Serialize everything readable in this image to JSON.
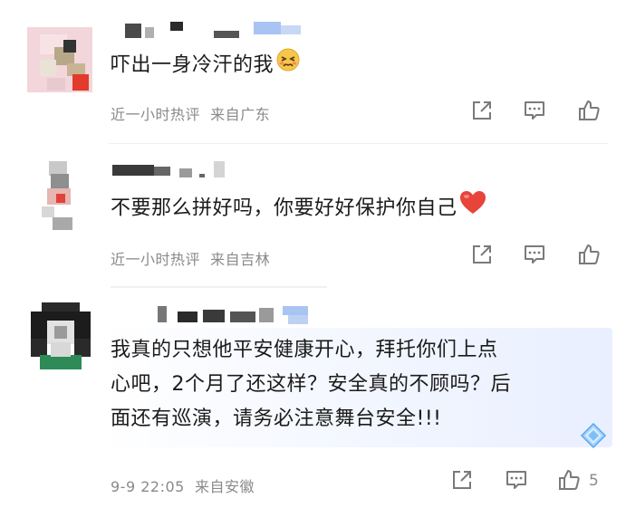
{
  "comments": [
    {
      "text": "吓出一身冷汗的我",
      "emoji": "sad-face-emoji",
      "meta": "近一小时热评  来自广东",
      "likes": ""
    },
    {
      "text": "不要那么拼好吗，你要好好保护你自己",
      "emoji": "red-heart-emoji",
      "meta": "近一小时热评  来自吉林",
      "likes": ""
    },
    {
      "text_lines": [
        "我真的只想他平安健康开心，拜托你们上点",
        "心吧，2个月了还这样？安全真的不顾吗？后",
        "面还有巡演，请务必注意舞台安全!!!"
      ],
      "meta": "9-9 22:05  来自安徽",
      "likes": "5"
    }
  ],
  "icons": {
    "share": "share-icon",
    "reply": "comment-icon",
    "like": "thumbs-up-icon",
    "badge": "diamond-badge-icon"
  },
  "colors": {
    "meta_text": "#8a8a8a",
    "heart": "#e8443a",
    "highlight": "#eef3ff"
  }
}
